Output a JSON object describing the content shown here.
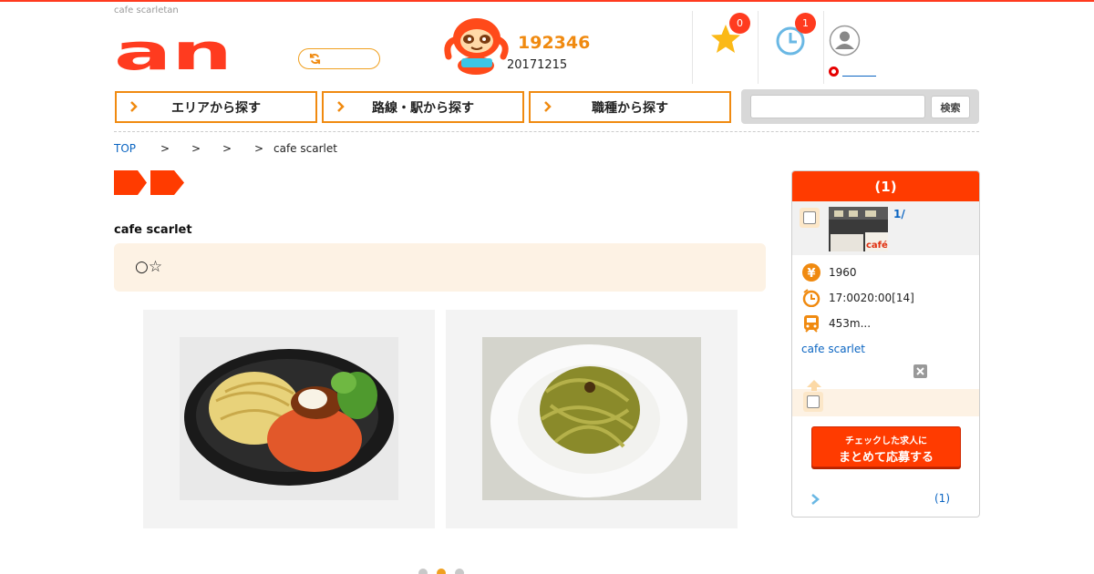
{
  "header": {
    "site_caption": "cafe scarletan",
    "logo_text": "an",
    "job_count": "192346",
    "job_date": "20171215",
    "favorites_count": "0",
    "history_count": "1"
  },
  "nav": {
    "area_label": "エリアから探す",
    "station_label": "路線・駅から探す",
    "occupation_label": "職種から探す"
  },
  "search": {
    "placeholder": "",
    "button_label": "検索"
  },
  "breadcrumb": {
    "top": "TOP",
    "sep1": ">",
    "sep2": ">",
    "sep3": ">",
    "sep4": ">",
    "current": "cafe scarlet"
  },
  "main": {
    "shop_name": "cafe scarlet",
    "catch_text": "○☆",
    "carousel": {
      "current_index": 2,
      "total": 3
    }
  },
  "sidebar": {
    "header": "(1)",
    "item": {
      "title": "1/",
      "salary": "1960",
      "hours": "17:0020:00[14]",
      "access": "453m...",
      "shop_link": "cafe scarlet"
    },
    "apply_line1": "チェックした求人に",
    "apply_line2": "まとめて応募する",
    "more_count": "(1)"
  },
  "colors": {
    "brand": "#ff3b1f",
    "accent_orange": "#f08a10",
    "link_blue": "#0b65c2",
    "cream": "#fdf2e4"
  }
}
